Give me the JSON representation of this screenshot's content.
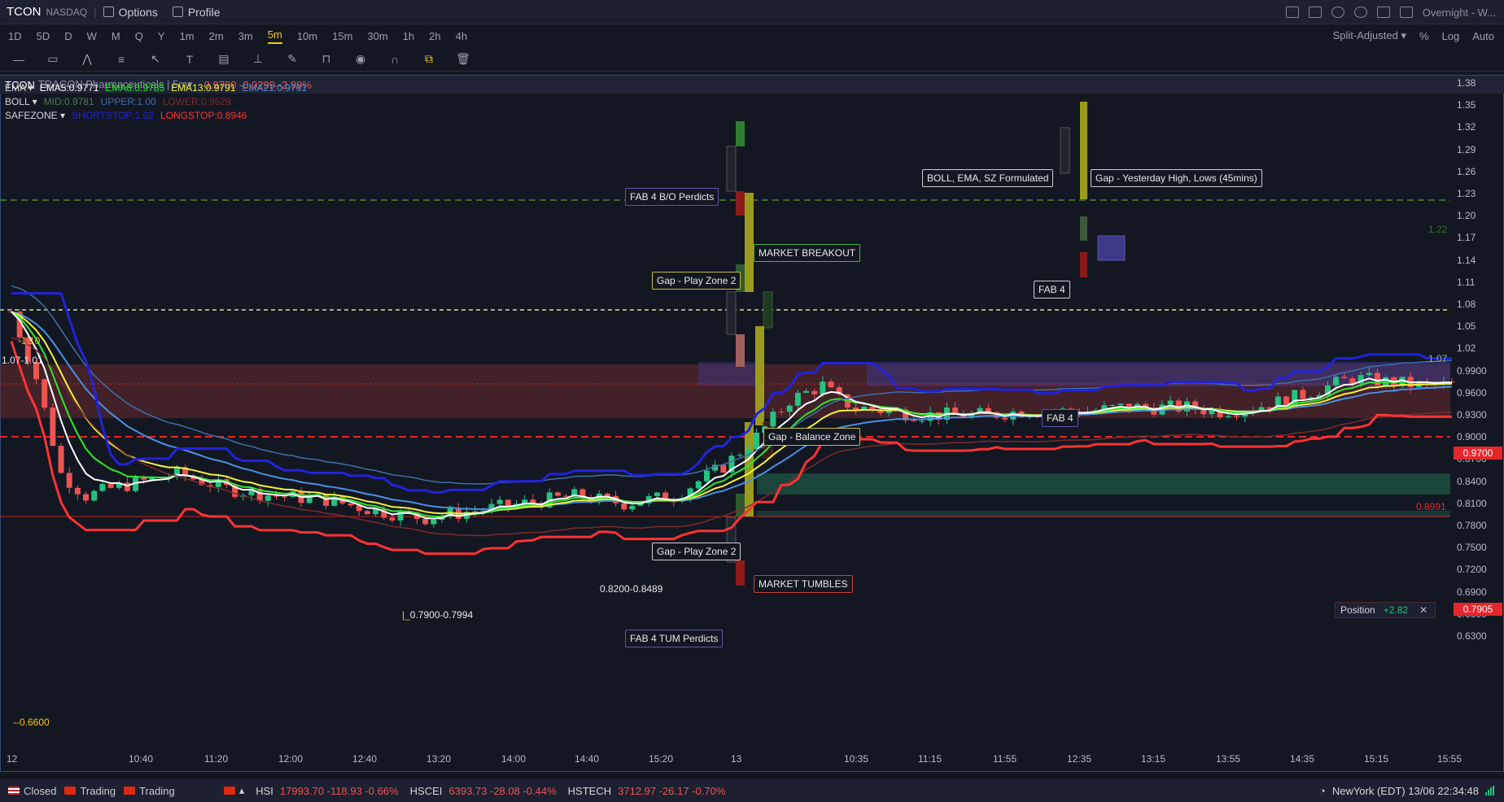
{
  "header": {
    "symbol": "TCON",
    "exchange": "NASDAQ",
    "menu": [
      {
        "label": "Options",
        "icon": "options-icon"
      },
      {
        "label": "Profile",
        "icon": "profile-icon"
      }
    ],
    "right_icons": [
      "screenshot-icon",
      "draw-icon",
      "refresh-icon",
      "settings-icon",
      "fullscreen-icon",
      "layout-icon"
    ],
    "session": "Overnight - W..."
  },
  "intervals": {
    "items": [
      "1D",
      "5D",
      "D",
      "W",
      "M",
      "Q",
      "Y",
      "1m",
      "2m",
      "3m",
      "5m",
      "10m",
      "15m",
      "30m",
      "1h",
      "2h",
      "4h"
    ],
    "active": "5m",
    "right": [
      "Split-Adjusted ▾",
      "%",
      "Log",
      "Auto"
    ]
  },
  "toolbar": {
    "tools": [
      "line-tool-icon",
      "rectangle-tool-icon",
      "pattern-tool-icon",
      "fib-tool-icon",
      "cursor-tool-icon",
      "text-tool-icon",
      "annotation-tool-icon",
      "measure-tool-icon",
      "pencil-icon",
      "lock-icon",
      "eye-icon",
      "magnet-icon",
      "link-icon",
      "trash-icon"
    ]
  },
  "chart_header": {
    "symbol": "TCON",
    "name": "TRACON Pharmaceuticals | 5m▾",
    "quote": "0.9700 -0.0299 -2.99%"
  },
  "indicators": [
    {
      "name": "EMA",
      "values": [
        {
          "text": "EMA5:0.9771",
          "color": "#ffffff"
        },
        {
          "text": "EMA8:0.9785",
          "color": "#2ee82e"
        },
        {
          "text": "EMA13:0.9791",
          "color": "#f2f23a"
        },
        {
          "text": "EMA21:0.9761",
          "color": "#4a90e2"
        }
      ]
    },
    {
      "name": "BOLL",
      "values": [
        {
          "text": "MID:0.9781",
          "color": "#4f7a4f"
        },
        {
          "text": "UPPER:1.00",
          "color": "#3f6fa8"
        },
        {
          "text": "LOWER:0.9529",
          "color": "#7a2b2b"
        }
      ]
    },
    {
      "name": "SAFEZONE",
      "values": [
        {
          "text": "SHORTSTOP:1.02",
          "color": "#2222dd"
        },
        {
          "text": "LONGSTOP:0.8946",
          "color": "#ff3333"
        }
      ]
    }
  ],
  "chart_data": {
    "type": "candlestick",
    "symbol": "TCON",
    "interval": "5m",
    "y_ticks": [
      "1.38",
      "1.35",
      "1.32",
      "1.29",
      "1.26",
      "1.23",
      "1.20",
      "1.17",
      "1.14",
      "1.11",
      "1.08",
      "1.05",
      "1.02",
      "0.9900",
      "0.9600",
      "0.9300",
      "0.9000",
      "0.8700",
      "0.8400",
      "0.8100",
      "0.7800",
      "0.7500",
      "0.7200",
      "0.6900",
      "0.6600",
      "0.6300"
    ],
    "x_ticks": [
      "12",
      "10:40",
      "11:20",
      "12:00",
      "12:40",
      "13:20",
      "14:00",
      "14:40",
      "15:20",
      "13",
      "10:35",
      "11:15",
      "11:55",
      "12:35",
      "13:15",
      "13:55",
      "14:35",
      "15:15",
      "15:55"
    ],
    "last_price": "0.9700",
    "position_price": "0.7905",
    "ylim": [
      0.625,
      1.385
    ],
    "levels": [
      {
        "label": "1.22",
        "value": 1.22,
        "color": "#3e6b2a"
      },
      {
        "label": "1.07",
        "value": 1.07,
        "color": "#9db07a"
      },
      {
        "label": "0.8991",
        "value": 0.8991,
        "color": "#e5262b"
      }
    ],
    "annotations": {
      "left_price_labels": [
        "1.10",
        "1.07-1.01",
        "0.6600",
        "0.7900-0.7994",
        "0.8200-0.8489"
      ]
    },
    "close_path": [
      [
        0,
        1.07
      ],
      [
        3,
        0.98
      ],
      [
        6,
        0.85
      ],
      [
        9,
        0.82
      ],
      [
        12,
        0.83
      ],
      [
        16,
        0.84
      ],
      [
        20,
        0.85
      ],
      [
        26,
        0.83
      ],
      [
        32,
        0.82
      ],
      [
        38,
        0.815
      ],
      [
        44,
        0.8
      ],
      [
        50,
        0.79
      ],
      [
        56,
        0.8
      ],
      [
        62,
        0.81
      ],
      [
        68,
        0.82
      ],
      [
        74,
        0.81
      ],
      [
        80,
        0.82
      ],
      [
        86,
        0.86
      ],
      [
        90,
        0.9
      ],
      [
        94,
        0.95
      ],
      [
        98,
        0.97
      ],
      [
        100,
        0.95
      ],
      [
        102,
        0.94
      ],
      [
        106,
        0.935
      ],
      [
        110,
        0.93
      ],
      [
        114,
        0.93
      ],
      [
        118,
        0.93
      ],
      [
        122,
        0.935
      ],
      [
        126,
        0.935
      ],
      [
        130,
        0.935
      ],
      [
        134,
        0.94
      ],
      [
        138,
        0.94
      ],
      [
        142,
        0.94
      ],
      [
        146,
        0.935
      ],
      [
        150,
        0.94
      ],
      [
        154,
        0.95
      ],
      [
        158,
        0.965
      ],
      [
        162,
        0.98
      ],
      [
        166,
        0.975
      ],
      [
        170,
        0.97
      ],
      [
        174,
        0.97
      ]
    ]
  },
  "annotations": [
    {
      "text": "FAB 4 B/O Perdicts",
      "style": "purple"
    },
    {
      "text": "MARKET BREAKOUT",
      "style": "green"
    },
    {
      "text": "Gap - Play Zone 2",
      "style": "yellow"
    },
    {
      "text": "Gap - Balance Zone",
      "style": "yellow"
    },
    {
      "text": "Gap - Play Zone 2",
      "style": "white"
    },
    {
      "text": "MARKET TUMBLES",
      "style": "red"
    },
    {
      "text": "FAB 4 TUM Perdicts",
      "style": "purple"
    },
    {
      "text": "BOLL, EMA, SZ Formulated",
      "style": "white"
    },
    {
      "text": "Gap - Yesterday High, Lows (45mins)",
      "style": "white"
    },
    {
      "text": "FAB 4",
      "style": "white"
    },
    {
      "text": "FAB 4",
      "style": "purple"
    }
  ],
  "position": {
    "label": "Position",
    "value": "+2.82"
  },
  "status": {
    "markets": [
      {
        "flag": "us",
        "label": "Closed"
      },
      {
        "flag": "hk",
        "label": "Trading"
      },
      {
        "flag": "cn",
        "label": "Trading"
      }
    ],
    "indices": [
      {
        "name": "HSI",
        "value": "17993.70 -118.93 -0.66%"
      },
      {
        "name": "HSCEI",
        "value": "6393.73 -28.08 -0.44%"
      },
      {
        "name": "HSTECH",
        "value": "3712.97 -26.17 -0.70%"
      }
    ],
    "clock": "NewYork (EDT) 13/06 22:34:48"
  },
  "colors": {
    "up": "#26c281",
    "down": "#ef5350",
    "accent": "#f5c518",
    "bg": "#131722"
  }
}
